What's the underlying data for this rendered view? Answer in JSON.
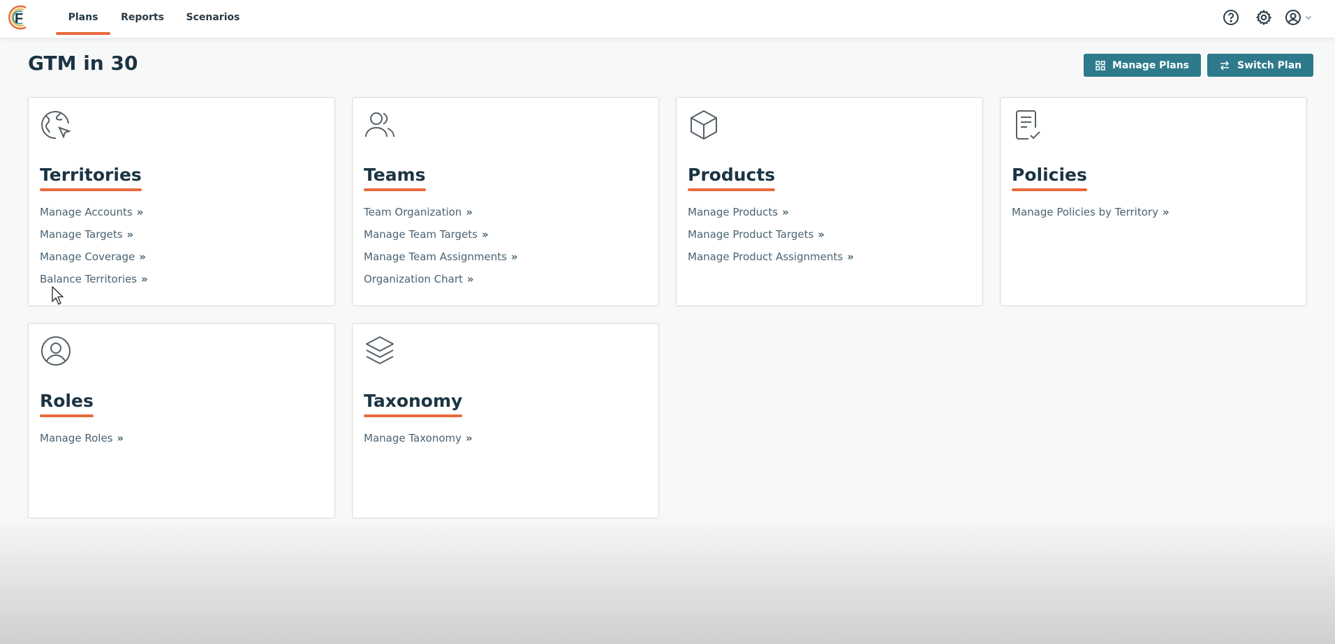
{
  "nav": {
    "tabs": [
      {
        "label": "Plans",
        "active": true
      },
      {
        "label": "Reports",
        "active": false
      },
      {
        "label": "Scenarios",
        "active": false
      }
    ]
  },
  "header": {
    "title": "GTM in 30",
    "manage_plans_label": "Manage Plans",
    "switch_plan_label": "Switch Plan"
  },
  "cards": [
    {
      "title": "Territories",
      "icon": "globe-cursor-icon",
      "links": [
        "Manage Accounts",
        "Manage Targets",
        "Manage Coverage",
        "Balance Territories"
      ]
    },
    {
      "title": "Teams",
      "icon": "users-icon",
      "links": [
        "Team Organization",
        "Manage Team Targets",
        "Manage Team Assignments",
        "Organization Chart"
      ]
    },
    {
      "title": "Products",
      "icon": "box-icon",
      "links": [
        "Manage Products",
        "Manage Product Targets",
        "Manage Product Assignments"
      ]
    },
    {
      "title": "Policies",
      "icon": "document-check-icon",
      "links": [
        "Manage Policies by Territory"
      ]
    },
    {
      "title": "Roles",
      "icon": "user-circle-icon",
      "links": [
        "Manage Roles"
      ]
    },
    {
      "title": "Taxonomy",
      "icon": "layers-icon",
      "links": [
        "Manage Taxonomy"
      ]
    }
  ],
  "link_suffix": "»",
  "colors": {
    "accent": "#e8693b",
    "button": "#2d7a8c",
    "heading": "#1b3443",
    "link": "#4a6272"
  }
}
